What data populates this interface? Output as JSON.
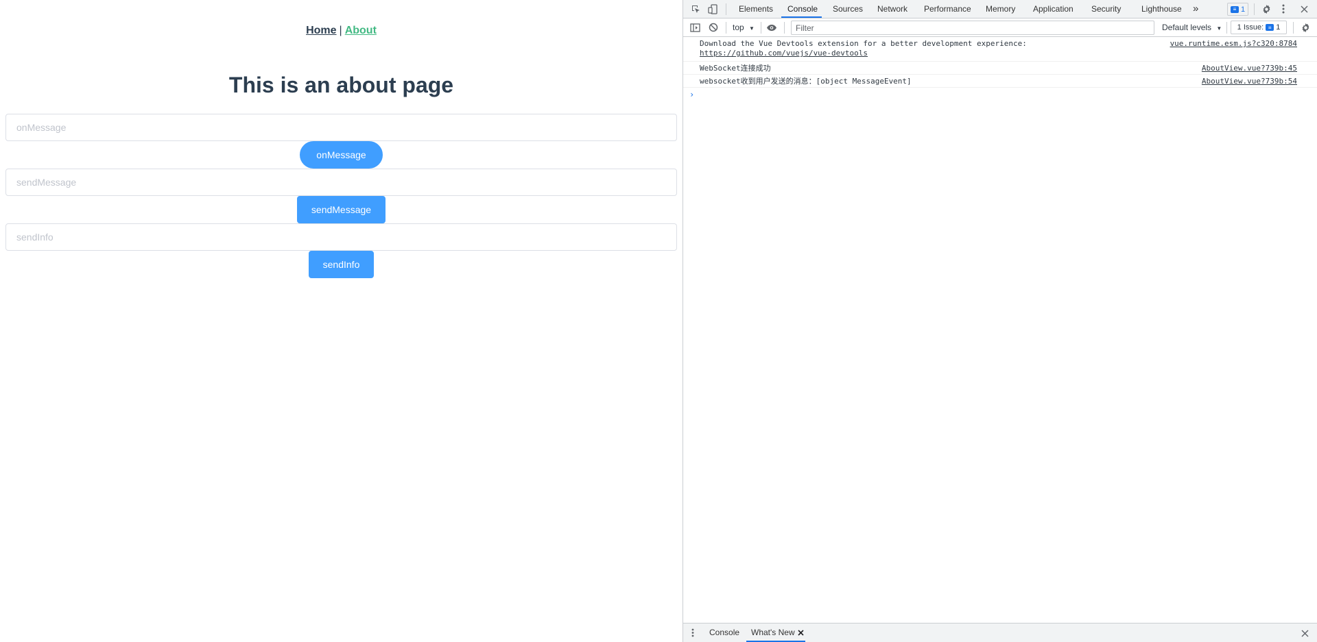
{
  "nav": {
    "home": "Home",
    "separator": "|",
    "about": "About"
  },
  "title": "This is an about page",
  "form": {
    "on_message_placeholder": "onMessage",
    "on_message_button": "onMessage",
    "send_message_placeholder": "sendMessage",
    "send_message_button": "sendMessage",
    "send_info_placeholder": "sendInfo",
    "send_info_button": "sendInfo"
  },
  "devtools": {
    "tabs": [
      "Elements",
      "Console",
      "Sources",
      "Network",
      "Performance",
      "Memory",
      "Application",
      "Security",
      "Lighthouse"
    ],
    "selected_tab": "Console",
    "more_tabs": "»",
    "messages_badge": "1",
    "toolbar": {
      "context": "top",
      "filter_placeholder": "Filter",
      "levels": "Default levels",
      "issues_label": "1 Issue:",
      "issues_count": "1"
    },
    "console": [
      {
        "text": "Download the Vue Devtools extension for a better development experience:",
        "link": "https://github.com/vuejs/vue-devtools",
        "source": "vue.runtime.esm.js?c320:8784"
      },
      {
        "text": "WebSocket连接成功",
        "source": "AboutView.vue?739b:45"
      },
      {
        "text": "websocket收到用户发送的消息：[object MessageEvent]",
        "source": "AboutView.vue?739b:54"
      }
    ],
    "prompt": "›",
    "drawer": {
      "console": "Console",
      "whats_new": "What's New"
    }
  },
  "colors": {
    "primary": "#409eff",
    "link_active": "#42b983",
    "text": "#2c3e50",
    "devtools_accent": "#1a73e8"
  }
}
